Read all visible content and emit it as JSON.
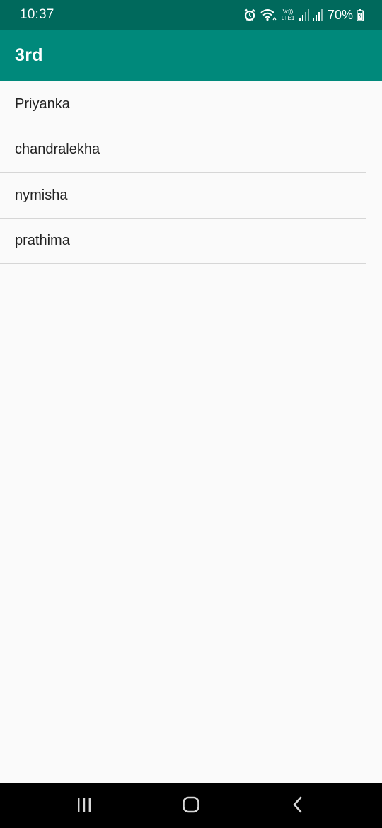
{
  "status_bar": {
    "time": "10:37",
    "battery_percent": "70%",
    "volte_top": "Vo))",
    "volte_bottom": "LTE1",
    "icons": [
      "alarm-icon",
      "wifi-icon",
      "volte-icon",
      "signal-icon",
      "signal-icon",
      "battery-charging-icon"
    ]
  },
  "toolbar": {
    "title": "3rd"
  },
  "list": {
    "items": [
      {
        "label": "Priyanka"
      },
      {
        "label": "chandralekha"
      },
      {
        "label": "nymisha"
      },
      {
        "label": "prathima"
      }
    ]
  },
  "nav_bar": {
    "icons": [
      "recent-apps-icon",
      "home-icon",
      "back-icon"
    ]
  },
  "colors": {
    "status_bar": "#00695c",
    "toolbar": "#00897b",
    "background": "#fafafa",
    "divider": "#d6d6d6",
    "nav_bar": "#000000"
  }
}
